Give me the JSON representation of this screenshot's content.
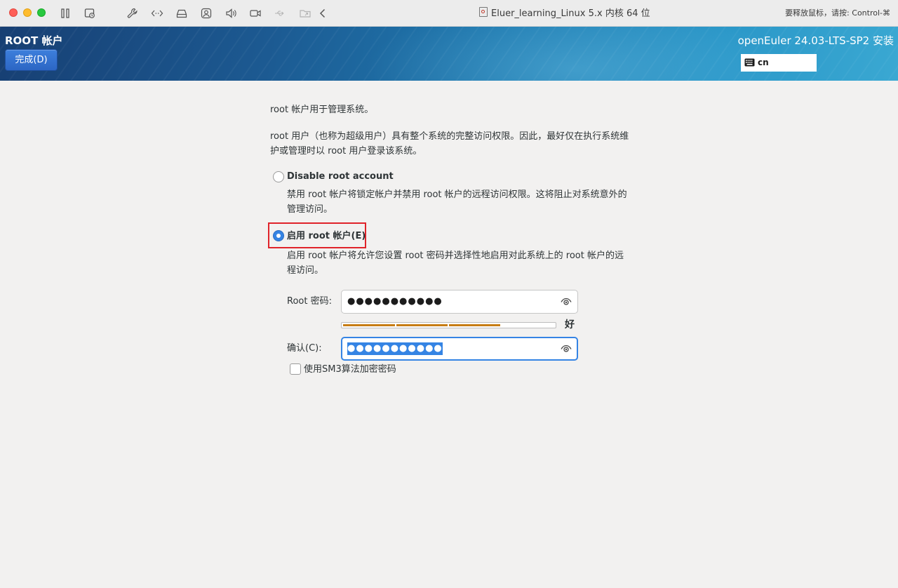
{
  "window": {
    "title": "Eluer_learning_Linux 5.x 内核 64 位",
    "release_hint": "要释放鼠标，请按: Control-⌘",
    "toolbar_icons": [
      "pause-icon",
      "snapshot-icon",
      "wrench-icon",
      "code-icon",
      "drive-icon",
      "user-lock-icon",
      "speaker-icon",
      "camera-icon",
      "usb-icon",
      "folder-share-icon",
      "chevron-left-icon"
    ]
  },
  "header": {
    "spoke_title": "ROOT 帐户",
    "done_label": "完成(D)",
    "product_title": "openEuler 24.03-LTS-SP2 安装",
    "keyboard_layout": "cn"
  },
  "content": {
    "intro": "root 帐户用于管理系统。",
    "description_line1": "root 用户（也称为超级用户）具有整个系统的完整访问权限。因此，最好仅在执行系统维",
    "description_line2": "护或管理时以 root 用户登录该系统。",
    "disable_option": {
      "label": "Disable root account",
      "help_line1": "禁用 root 帐户将锁定帐户并禁用 root 帐户的远程访问权限。这将阻止对系统意外的",
      "help_line2": "管理访问。",
      "checked": false
    },
    "enable_option": {
      "label": "启用 root 帐户(E)",
      "help_line1": "启用 root 帐户将允许您设置 root 密码并选择性地启用对此系统上的 root 帐户的远",
      "help_line2": "程访问。",
      "checked": true
    },
    "password": {
      "label": "Root 密码:",
      "value": "●●●●●●●●●●●"
    },
    "strength": {
      "label": "好",
      "fraction": 0.75
    },
    "confirm": {
      "label": "确认(C):",
      "value": "●●●●●●●●●●●"
    },
    "sm3_checkbox": {
      "label": "使用SM3算法加密密码",
      "checked": false
    }
  },
  "colors": {
    "accent": "#3584e4",
    "strength_bar": "#c77d14",
    "highlight": "#e0232a"
  }
}
